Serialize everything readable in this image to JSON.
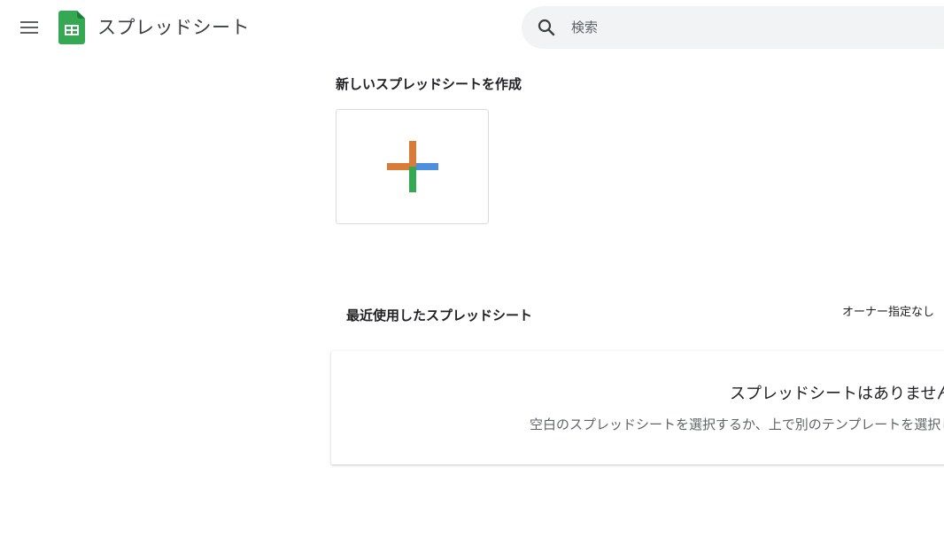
{
  "header": {
    "app_title": "スプレッドシート",
    "menu_icon": "hamburger-menu-icon",
    "logo_icon": "sheets-logo-icon",
    "logo_color": "#34a853"
  },
  "search": {
    "placeholder": "検索",
    "icon": "search-icon",
    "background": "#f1f3f4"
  },
  "create_section": {
    "heading": "新しいスプレッドシートを作成",
    "blank_card_icon": "plus-icon",
    "plus_colors": [
      "#d97b39",
      "#4a8fe0",
      "#34a853"
    ]
  },
  "recent_section": {
    "heading": "最近使用したスプレッドシート",
    "owner_filter": "オーナー指定なし",
    "empty_title": "スプレッドシートはありません",
    "empty_subtitle": "空白のスプレッドシートを選択するか、上で別のテンプレートを選択してください"
  }
}
